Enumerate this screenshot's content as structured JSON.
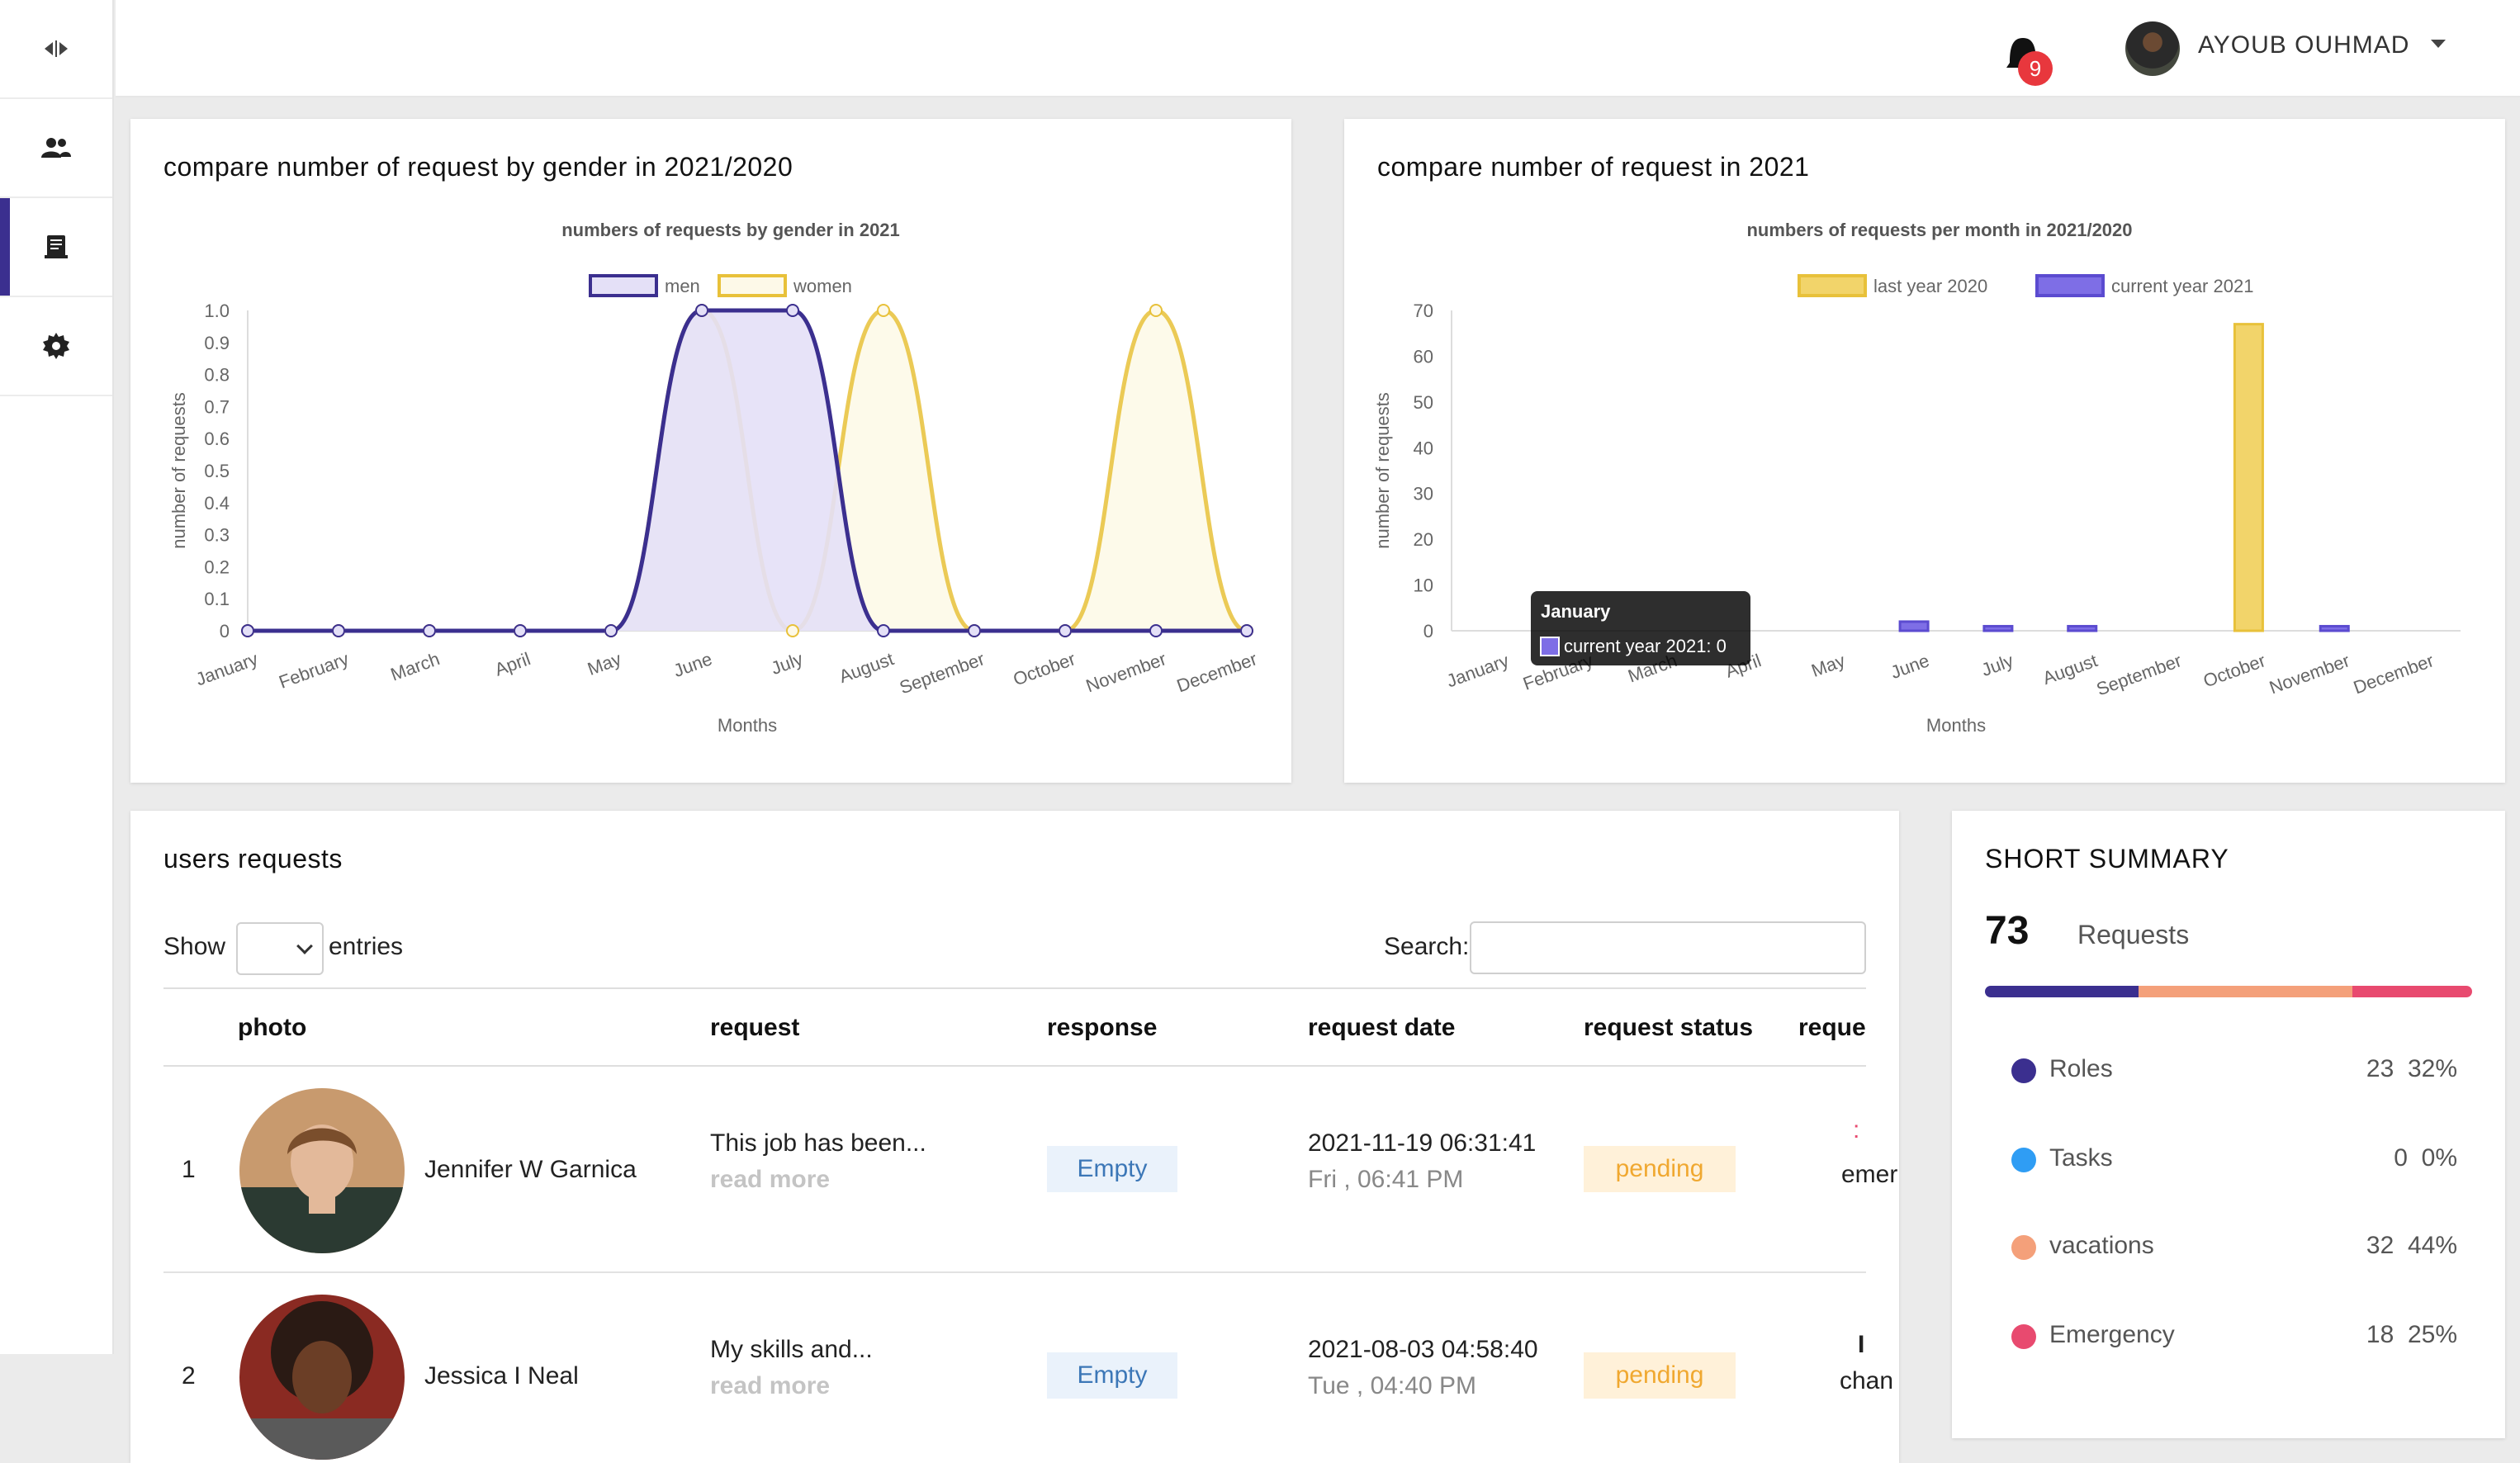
{
  "topbar": {
    "notif_count": "9",
    "user_name": "AYOUB OUHMAD"
  },
  "sidebar": {
    "items": [
      {
        "icon": "sidebar-toggle-icon"
      },
      {
        "icon": "users-icon"
      },
      {
        "icon": "requests-icon",
        "active": true
      },
      {
        "icon": "gear-icon"
      }
    ]
  },
  "gender_card": {
    "title": "compare number of request by gender in 2021/2020"
  },
  "year_card": {
    "title": "compare number of request in 2021"
  },
  "table": {
    "title": "users requests",
    "show_label": "Show",
    "entries_label": "entries",
    "search_label": "Search:",
    "columns": [
      "photo",
      "request",
      "response",
      "request date",
      "request status",
      "reque"
    ],
    "rows": [
      {
        "index": "1",
        "name": "Jennifer W Garnica",
        "request": "This job has been...",
        "read_more": "read more",
        "response": "Empty",
        "date": "2021-11-19 06:31:41",
        "date_sub": "Fri , 06:41 PM",
        "status": "pending",
        "extra_top": ":",
        "extra": "emer"
      },
      {
        "index": "2",
        "name": "Jessica I Neal",
        "request": "My skills and...",
        "read_more": "read more",
        "response": "Empty",
        "date": "2021-08-03 04:58:40",
        "date_sub": "Tue , 04:40 PM",
        "status": "pending",
        "extra_top": "I",
        "extra": "chan"
      }
    ]
  },
  "summary": {
    "title": "SHORT SUMMARY",
    "total": "73",
    "total_label": "Requests",
    "items": [
      {
        "name": "Roles",
        "count": "23",
        "pct": "32%",
        "color": "#3b2f8f"
      },
      {
        "name": "Tasks",
        "count": "0",
        "pct": "0%",
        "color": "#2f9df4"
      },
      {
        "name": "vacations",
        "count": "32",
        "pct": "44%",
        "color": "#f4a07a"
      },
      {
        "name": "Emergency",
        "count": "18",
        "pct": "25%",
        "color": "#e84a6f"
      }
    ]
  },
  "chart_data": [
    {
      "type": "area",
      "title": "numbers of requests by gender in 2021",
      "xlabel": "Months",
      "ylabel": "number of requests",
      "ylim": [
        0,
        1
      ],
      "yticks": [
        "0",
        "0.1",
        "0.2",
        "0.3",
        "0.4",
        "0.5",
        "0.6",
        "0.7",
        "0.8",
        "0.9",
        "1.0"
      ],
      "categories": [
        "January",
        "February",
        "March",
        "April",
        "May",
        "June",
        "July",
        "August",
        "September",
        "October",
        "November",
        "December"
      ],
      "legend": "top-center",
      "series": [
        {
          "name": "men",
          "values": [
            0,
            0,
            0,
            0,
            0,
            1,
            1,
            0,
            0,
            0,
            0,
            0
          ],
          "color": "#3b2f8f",
          "fill": "#e4e0f7"
        },
        {
          "name": "women",
          "values": [
            0,
            0,
            0,
            0,
            0,
            1,
            0,
            1,
            0,
            0,
            1,
            0
          ],
          "color": "#e8c13a",
          "fill": "#fdf9e8"
        }
      ]
    },
    {
      "type": "bar",
      "title": "numbers of requests per month  in 2021/2020",
      "xlabel": "Months",
      "ylabel": "number of requests",
      "ylim": [
        0,
        70
      ],
      "yticks": [
        "0",
        "10",
        "20",
        "30",
        "40",
        "50",
        "60",
        "70"
      ],
      "categories": [
        "January",
        "February",
        "March",
        "April",
        "May",
        "June",
        "July",
        "August",
        "September",
        "October",
        "November",
        "December"
      ],
      "legend": "top-center",
      "series": [
        {
          "name": "last year 2020",
          "values": [
            0,
            0,
            0,
            0,
            0,
            0,
            0,
            0,
            0,
            67,
            0,
            0
          ],
          "color": "#f2d46a",
          "border": "#e8c13a"
        },
        {
          "name": "current year 2021",
          "values": [
            0,
            0,
            0,
            0,
            0,
            2,
            1,
            1,
            0,
            0,
            1,
            0
          ],
          "color": "#7e6ee6",
          "border": "#5b4bd0"
        }
      ],
      "tooltip": {
        "title": "January",
        "text": "current year 2021: 0"
      }
    }
  ]
}
